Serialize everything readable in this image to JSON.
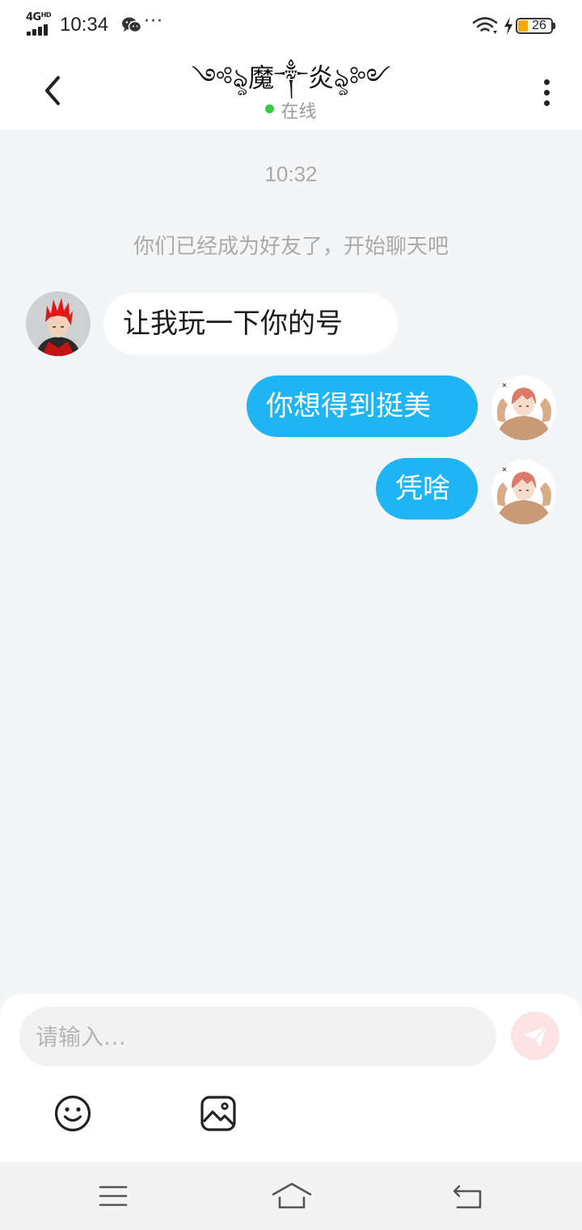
{
  "status_bar": {
    "network": "4G",
    "network_suffix": "HD",
    "time": "10:34",
    "overflow": "···",
    "battery": "26",
    "icons": [
      "signal-icon",
      "wechat-icon",
      "wifi-icon",
      "charging-icon",
      "battery-icon"
    ]
  },
  "header": {
    "title": "༺ৡ魔༒炎ৡ༻",
    "status": "在线",
    "status_color": "#2fcb4a",
    "icons": [
      "back-arrow-icon",
      "more-vertical-icon"
    ]
  },
  "conversation": {
    "timestamp": "10:32",
    "system_notice": "你们已经成为好友了，开始聊天吧",
    "messages": [
      {
        "direction": "incoming",
        "text": "让我玩一下你的号",
        "avatar": "red-hair-anime-avatar"
      },
      {
        "direction": "outgoing",
        "text": "你想得到挺美",
        "avatar": "pink-hair-anime-avatar"
      },
      {
        "direction": "outgoing",
        "text": "凭啥",
        "avatar": "pink-hair-anime-avatar"
      }
    ]
  },
  "composer": {
    "placeholder": "请输入…",
    "value": "",
    "icons": [
      "send-icon",
      "emoji-icon",
      "image-icon"
    ]
  },
  "nav_bar": {
    "icons": [
      "menu-icon",
      "home-icon",
      "back-icon"
    ]
  },
  "colors": {
    "outgoing_bubble": "#1fb5f5",
    "incoming_bubble": "#ffffff",
    "background": "#f4f5f7",
    "send_button": "#fde3e3"
  }
}
